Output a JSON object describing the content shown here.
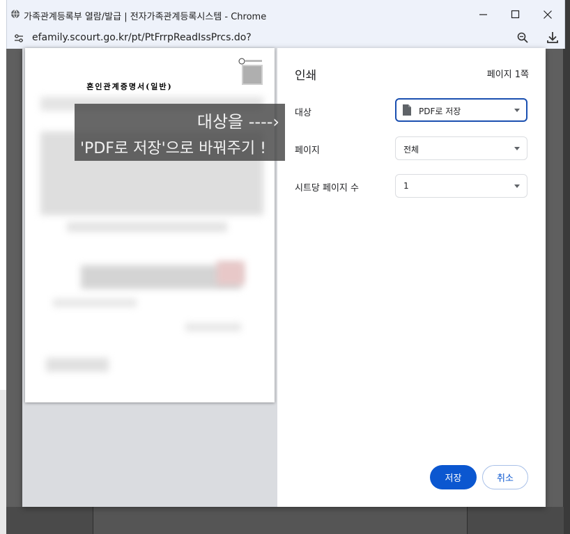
{
  "window": {
    "title": "가족관계등록부 열람/발급 | 전자가족관계등록시스템 - Chrome",
    "url": "efamily.scourt.go.kr/pt/PtFrrpReadIssPrcs.do?"
  },
  "preview": {
    "doc_title": "혼인관계증명서(일반)",
    "annotation_line1": "대상을 ----›",
    "annotation_line2": "'PDF로 저장'으로 바꿔주기 !"
  },
  "print": {
    "heading": "인쇄",
    "page_count": "페이지 1쪽",
    "destination_label": "대상",
    "destination_value": "PDF로 저장",
    "pages_label": "페이지",
    "pages_value": "전체",
    "pages_per_sheet_label": "시트당 페이지 수",
    "pages_per_sheet_value": "1",
    "save_button": "저장",
    "cancel_button": "취소"
  },
  "colors": {
    "accent": "#0b57d0",
    "focus_border": "#1a4fb0",
    "titlebar_bg": "#eef2fa"
  },
  "icons": [
    "globe-icon",
    "minimize-icon",
    "maximize-icon",
    "close-icon",
    "site-settings-icon",
    "zoom-icon",
    "download-icon",
    "file-icon",
    "qr-code-icon",
    "dropdown-arrow-icon"
  ]
}
